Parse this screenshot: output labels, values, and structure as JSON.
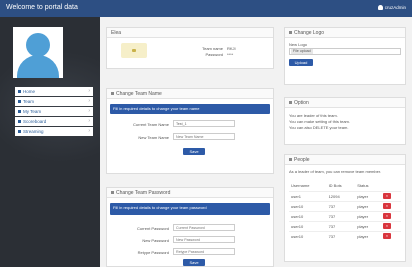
{
  "topbar": {
    "title": "Welcome to portal data",
    "user": "cruzAdmin"
  },
  "sidebar": {
    "items": [
      {
        "label": "Home",
        "icon": "home-icon"
      },
      {
        "label": "Team",
        "icon": "team-icon"
      },
      {
        "label": "My Team",
        "icon": "my-team-icon"
      },
      {
        "label": "Scoreboard",
        "icon": "scoreboard-icon"
      },
      {
        "label": "Streaming",
        "icon": "streaming-icon"
      }
    ]
  },
  "team_info": {
    "title": "Elea",
    "team_name_label": "Team name",
    "team_name_value": "RKJI",
    "password_label": "Password",
    "password_value": "****"
  },
  "change_logo": {
    "title": "Change Logo",
    "new_logo_label": "New Logo",
    "file_button": "File upload",
    "upload_button": "Upload"
  },
  "change_name": {
    "title": "Change Team Name",
    "alert": "Fill in required details to change your team name",
    "current_label": "Current Team Name",
    "current_value": "Test_1",
    "new_label": "New Team Name",
    "new_placeholder": "New Team Name",
    "save_button": "Save"
  },
  "option": {
    "title": "Option",
    "text1": "You are leader of this team.",
    "text2": "You can make setting of this team.",
    "text3": "You can also DELETE your team."
  },
  "people": {
    "title": "People",
    "description": "As a leader of team, you can remove team member.",
    "headers": [
      "Username",
      "ID Bots",
      "Status",
      ""
    ],
    "rows": [
      {
        "username": "user1",
        "id": "12094",
        "status": "player"
      },
      {
        "username": "user10",
        "id": "737",
        "player": "",
        "status": "player"
      },
      {
        "username": "user10",
        "id": "737",
        "status": "player"
      },
      {
        "username": "user10",
        "id": "737",
        "status": "player"
      },
      {
        "username": "user10",
        "id": "737",
        "status": "player"
      }
    ],
    "delete_label": "×"
  },
  "change_password": {
    "title": "Change Team Password",
    "alert": "Fill in required details to change your team password",
    "current_label": "Current Password",
    "current_placeholder": "Current Password",
    "new_label": "New Password",
    "new_placeholder": "New Password",
    "retype_label": "Retype Password",
    "retype_placeholder": "Retype Password",
    "save_button": "Save"
  }
}
